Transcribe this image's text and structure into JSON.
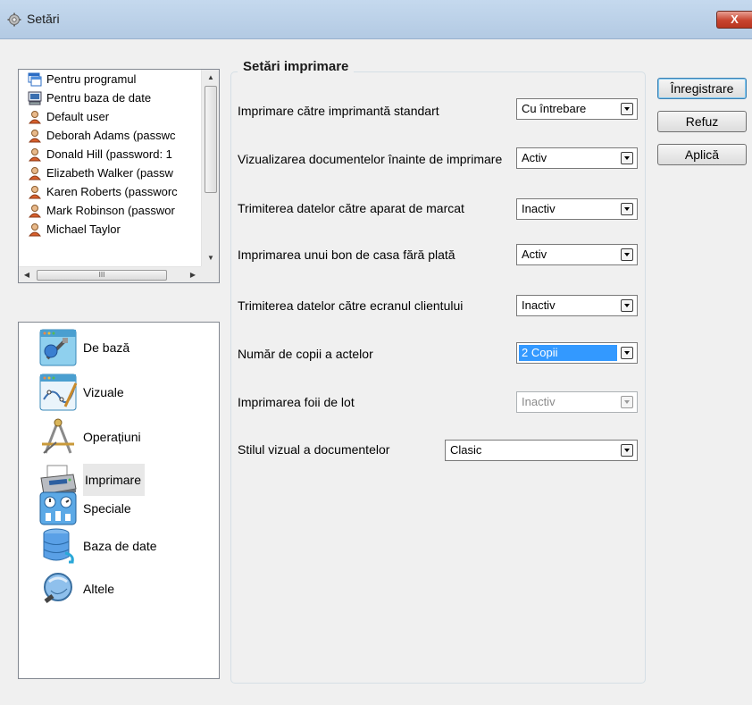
{
  "window": {
    "title": "Setări",
    "icon": "gear-icon",
    "close_label": "X"
  },
  "users": {
    "items": [
      {
        "label": "Pentru programul",
        "icon": "program-icon"
      },
      {
        "label": "Pentru baza de date",
        "icon": "computer-icon"
      },
      {
        "label": "Default user",
        "icon": "user-icon"
      },
      {
        "label": "Deborah Adams (passwc",
        "icon": "user-icon"
      },
      {
        "label": "Donald Hill (password: 1",
        "icon": "user-icon"
      },
      {
        "label": "Elizabeth Walker (passw",
        "icon": "user-icon"
      },
      {
        "label": "Karen Roberts (passworc",
        "icon": "user-icon"
      },
      {
        "label": "Mark Robinson (passwor",
        "icon": "user-icon"
      },
      {
        "label": "Michael Taylor",
        "icon": "user-icon"
      }
    ]
  },
  "categories": {
    "items": [
      {
        "label": "De bază",
        "icon": "basic-settings-icon"
      },
      {
        "label": "Vizuale",
        "icon": "visual-icon"
      },
      {
        "label": "Operațiuni",
        "icon": "operations-icon"
      },
      {
        "label": "Imprimare",
        "icon": "printer-icon",
        "selected": true
      },
      {
        "label": "Speciale",
        "icon": "special-icon"
      },
      {
        "label": "Baza de date",
        "icon": "database-icon"
      },
      {
        "label": "Altele",
        "icon": "other-icon"
      }
    ]
  },
  "print_settings": {
    "title": "Setări imprimare",
    "rows": [
      {
        "label": "Imprimare către imprimantă standart",
        "value": "Cu întrebare"
      },
      {
        "label": "Vizualizarea documentelor înainte de imprimare",
        "value": "Activ"
      },
      {
        "label": "Trimiterea datelor către aparat de marcat",
        "value": "Inactiv"
      },
      {
        "label": "Imprimarea unui bon de casa fără plată",
        "value": "Activ"
      },
      {
        "label": "Trimiterea datelor către ecranul clientului",
        "value": "Inactiv"
      },
      {
        "label": "Număr de copii a actelor",
        "value": "2 Copii"
      },
      {
        "label": "Imprimarea foii de lot",
        "value": "Inactiv"
      },
      {
        "label": "Stilul vizual a documentelor",
        "value": "Clasic"
      }
    ]
  },
  "buttons": {
    "save": "Înregistrare",
    "cancel": "Refuz",
    "apply": "Aplică"
  },
  "scroll": {
    "hthumb_grip": "III"
  },
  "colors": {
    "selection": "#3399ff",
    "titlebar": "#c5d9ee",
    "close": "#c7432e"
  }
}
